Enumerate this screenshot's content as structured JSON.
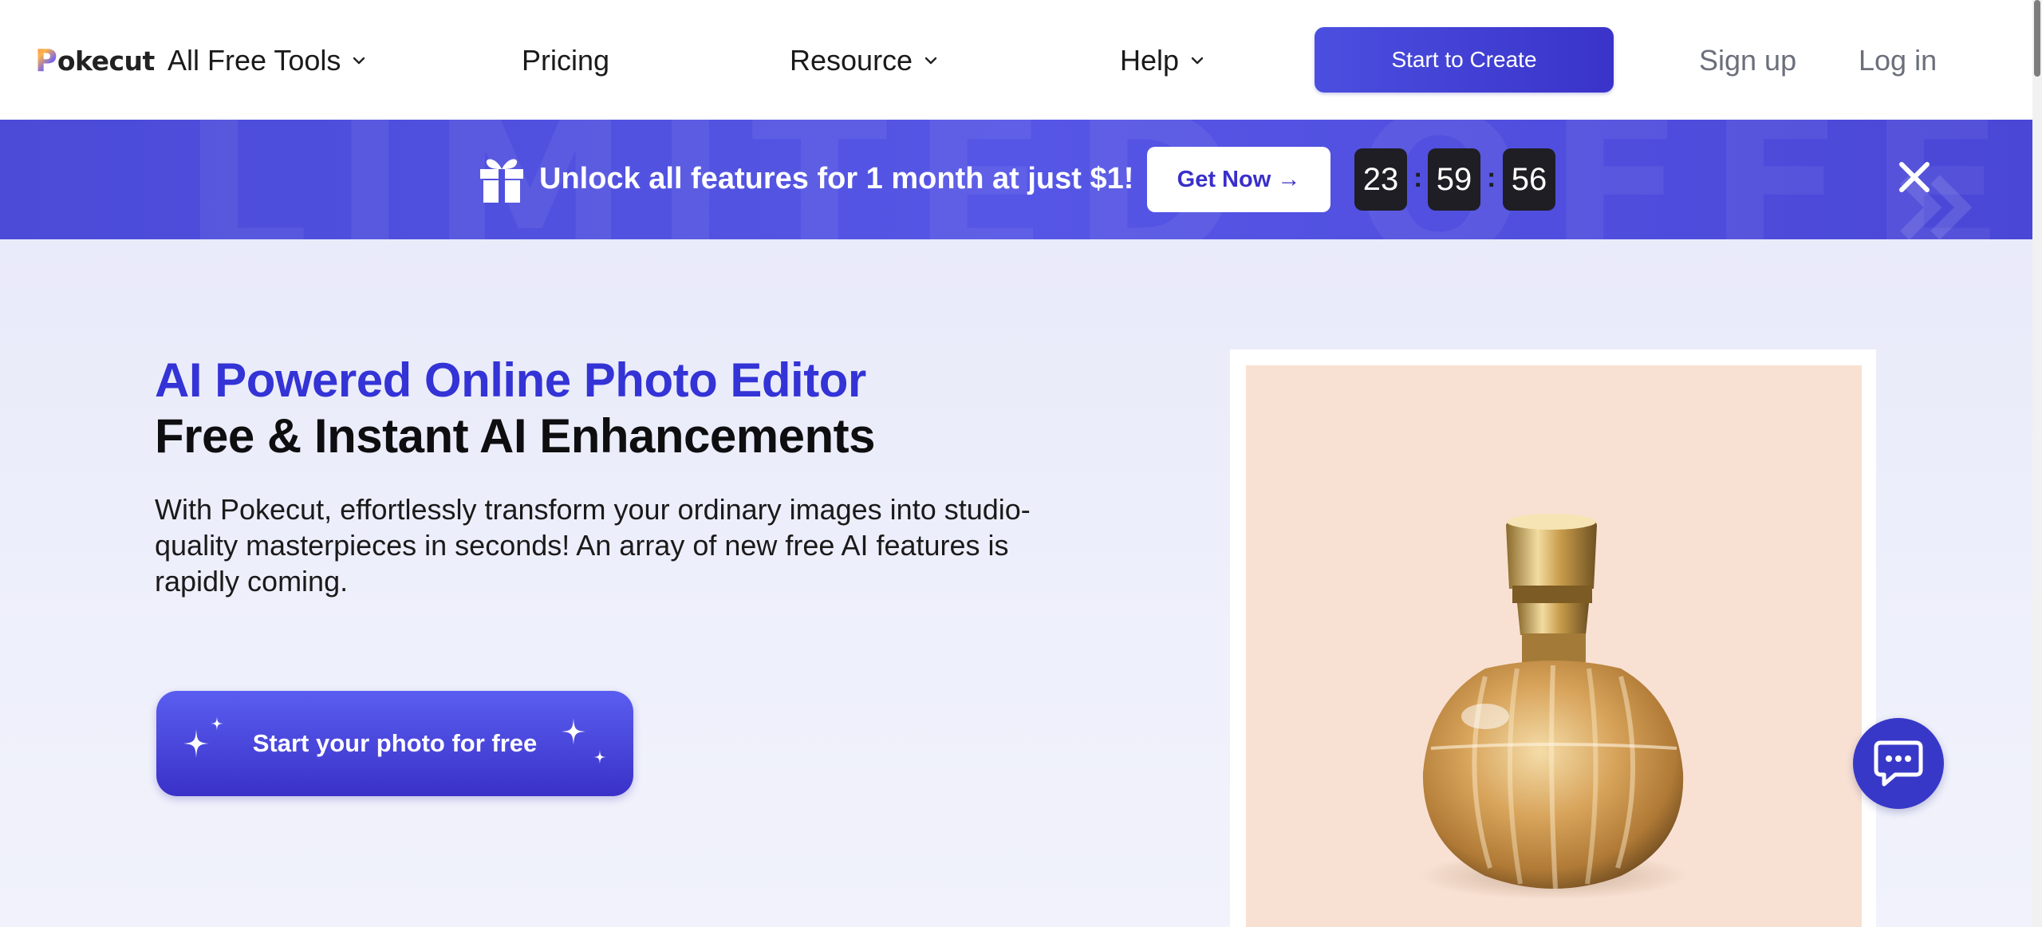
{
  "header": {
    "logo_first": "P",
    "logo_rest": "okecut",
    "nav": {
      "free_tools": "All Free Tools",
      "pricing": "Pricing",
      "resource": "Resource",
      "help": "Help"
    },
    "start_create": "Start to Create",
    "sign_up": "Sign up",
    "log_in": "Log in"
  },
  "banner": {
    "watermark": "LIMITED OFFER",
    "promo": "Unlock all features for 1 month at just $1!",
    "get_now": "Get Now →",
    "timer": {
      "hours": "23",
      "minutes": "59",
      "seconds": "56",
      "separator": ":"
    }
  },
  "hero": {
    "title_blue": "AI Powered Online Photo Editor",
    "title_black": "Free & Instant AI Enhancements",
    "description": "With Pokecut, effortlessly transform your ordinary images into studio-quality masterpieces in seconds! An array of new free AI features is rapidly coming.",
    "cta": "Start your photo for free"
  },
  "colors": {
    "brand": "#3a33c9",
    "title_blue": "#3333d6",
    "banner": "#5050e0",
    "photo_bg": "#f8e1d3"
  },
  "icons": [
    "chevron-down-icon",
    "gift-icon",
    "close-icon",
    "sparkle-icon",
    "chat-icon",
    "perfume-bottle-image"
  ]
}
